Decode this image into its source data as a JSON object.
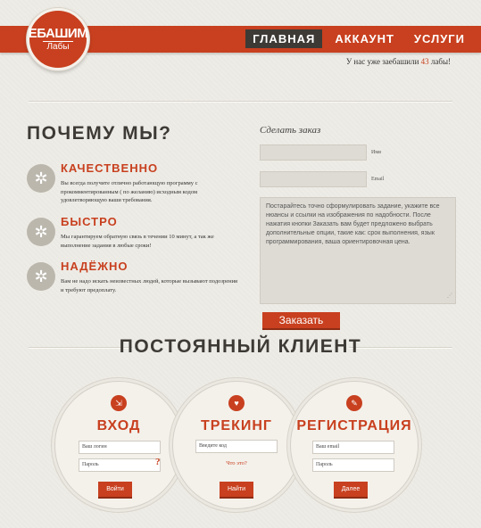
{
  "logo": {
    "main": "ЕБАШИМ",
    "sub": "Лабы"
  },
  "nav": {
    "items": [
      {
        "label": "ГЛАВНАЯ"
      },
      {
        "label": "АККАУНТ"
      },
      {
        "label": "УСЛУГИ"
      }
    ]
  },
  "counter": {
    "prefix": "У нас уже заебашили",
    "number": "43",
    "suffix": "лабы!"
  },
  "why": {
    "title": "ПОЧЕМУ МЫ?",
    "features": [
      {
        "title": "КАЧЕСТВЕННО",
        "text": "Вы всегда получите отлично работающую программу с прокомментированным ( по желанию) исходным кодом удовлетворяющую ваши требования."
      },
      {
        "title": "БЫСТРО",
        "text": "Мы гарантируем обратную связь в течении 10 минут, а так же выполнение задания в любые сроки!"
      },
      {
        "title": "НАДЁЖНО",
        "text": "Вам не надо искать неизвестных людей, которые вызывают подозрения и требуют предоплату."
      }
    ]
  },
  "order": {
    "title": "Сделать заказ",
    "name_label": "Имя",
    "email_label": "Email",
    "description": "Постарайтесь точно сформулировать задание, укажите все нюансы и ссылки на изображения по надобности. После нажатия кнопки Заказать вам будет предложено выбрать дополнительные опции, такие как: срок выполнения, язык программирования, ваша ориентировочная цена.",
    "submit": "Заказать"
  },
  "client": {
    "title": "ПОСТОЯННЫЙ КЛИЕНТ",
    "login": {
      "title": "ВХОД",
      "login_placeholder": "Ваш логин",
      "password_placeholder": "Пароль",
      "forgot": "?",
      "button": "Войти"
    },
    "tracking": {
      "title": "ТРЕКИНГ",
      "code_placeholder": "Введите код",
      "what": "Что это?",
      "button": "Найти"
    },
    "register": {
      "title": "РЕГИСТРАЦИЯ",
      "email_placeholder": "Ваш email",
      "password_placeholder": "Пароль",
      "button": "Далее"
    }
  }
}
